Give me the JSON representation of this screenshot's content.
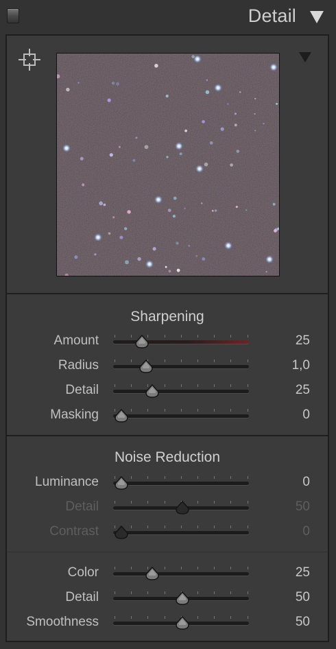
{
  "header": {
    "title": "Detail"
  },
  "preview": {
    "target_icon": "crosshair-icon",
    "menu_icon": "triangle-down-icon"
  },
  "sharpening": {
    "title": "Sharpening",
    "sliders": [
      {
        "label": "Amount",
        "value": "25",
        "fraction": 0.21,
        "disabled": false,
        "red": true
      },
      {
        "label": "Radius",
        "value": "1,0",
        "fraction": 0.24,
        "disabled": false,
        "red": false
      },
      {
        "label": "Detail",
        "value": "25",
        "fraction": 0.29,
        "disabled": false,
        "red": false
      },
      {
        "label": "Masking",
        "value": "0",
        "fraction": 0.06,
        "disabled": false,
        "red": false
      }
    ]
  },
  "noise_reduction": {
    "title": "Noise Reduction",
    "luminance": [
      {
        "label": "Luminance",
        "value": "0",
        "fraction": 0.06,
        "disabled": false,
        "red": false
      },
      {
        "label": "Detail",
        "value": "50",
        "fraction": 0.51,
        "disabled": true,
        "red": false
      },
      {
        "label": "Contrast",
        "value": "0",
        "fraction": 0.06,
        "disabled": true,
        "red": false
      }
    ],
    "color": [
      {
        "label": "Color",
        "value": "25",
        "fraction": 0.29,
        "disabled": false,
        "red": false
      },
      {
        "label": "Detail",
        "value": "50",
        "fraction": 0.51,
        "disabled": false,
        "red": false
      },
      {
        "label": "Smoothness",
        "value": "50",
        "fraction": 0.51,
        "disabled": false,
        "red": false
      }
    ]
  },
  "colors": {
    "panel_bg": "#3b3b3b",
    "track": "#1c1c1c",
    "amount_track_end": "#6a2626"
  }
}
